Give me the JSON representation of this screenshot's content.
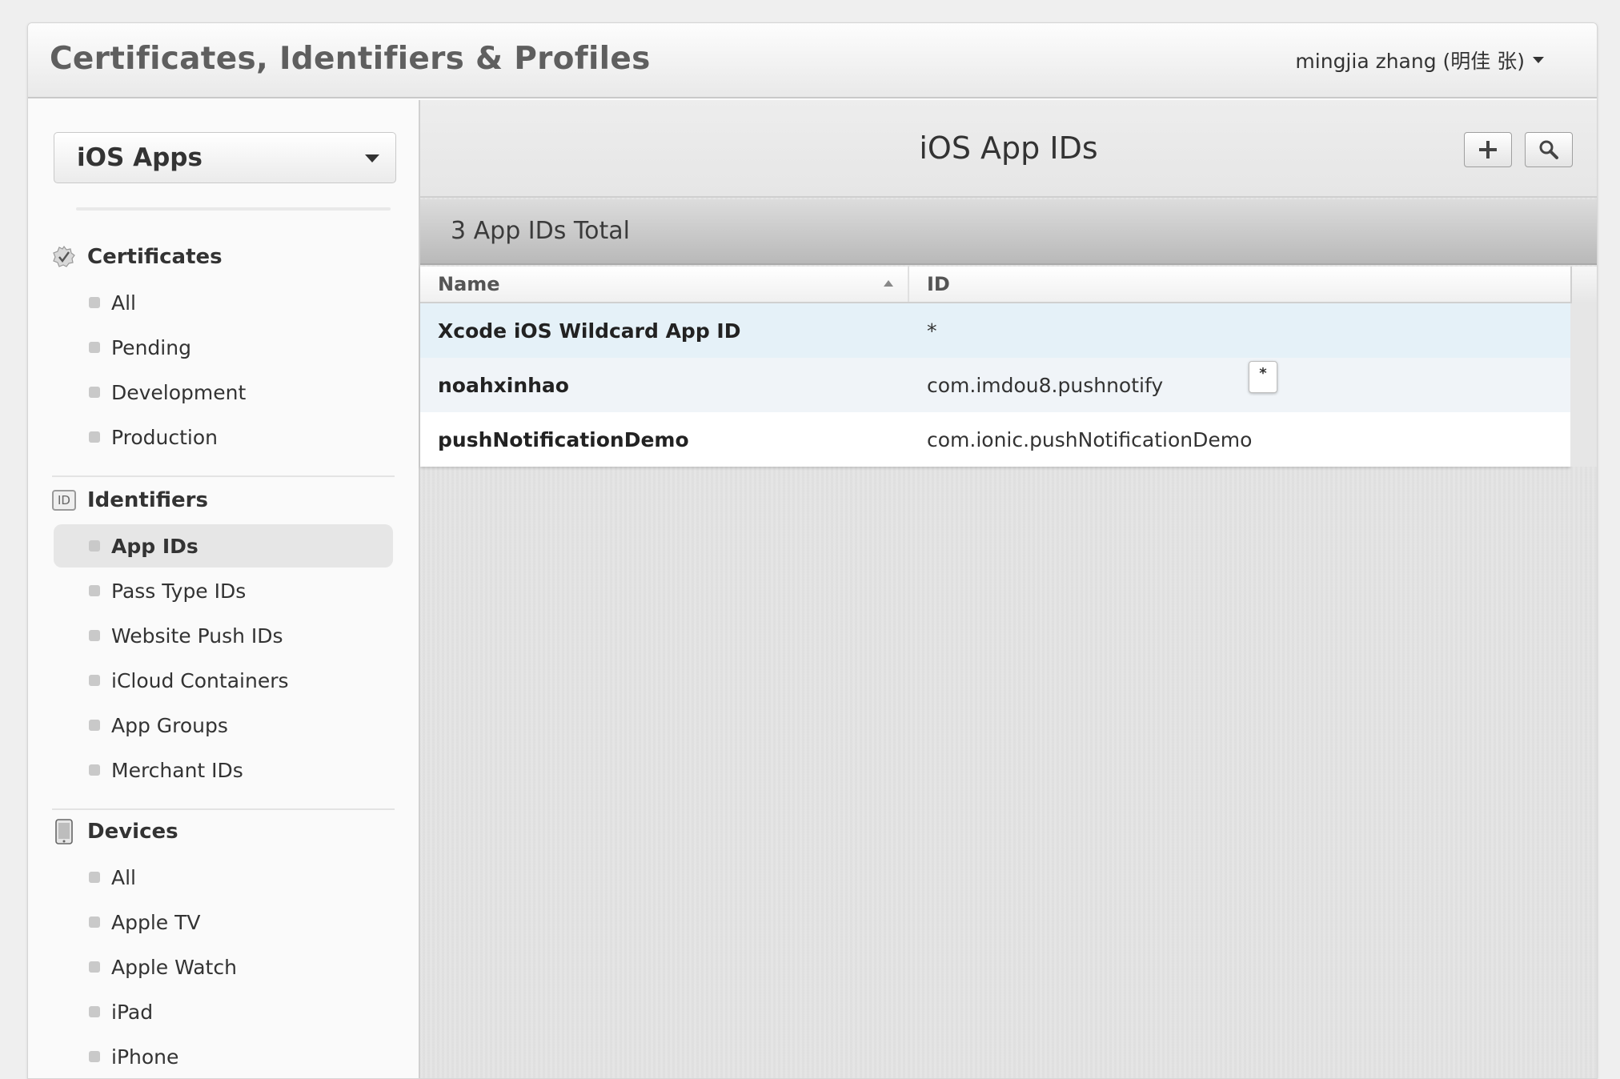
{
  "app": {
    "title": "Certificates, Identifiers & Profiles",
    "user": "mingjia zhang (明佳 张)"
  },
  "sidebar": {
    "platform": "iOS Apps",
    "sections": [
      {
        "title": "Certificates",
        "icon": "certificate-icon",
        "items": [
          "All",
          "Pending",
          "Development",
          "Production"
        ]
      },
      {
        "title": "Identifiers",
        "icon": "id-badge-icon",
        "icon_text": "ID",
        "items": [
          "App IDs",
          "Pass Type IDs",
          "Website Push IDs",
          "iCloud Containers",
          "App Groups",
          "Merchant IDs"
        ],
        "active_item": "App IDs"
      },
      {
        "title": "Devices",
        "icon": "device-icon",
        "items": [
          "All",
          "Apple TV",
          "Apple Watch",
          "iPad",
          "iPhone"
        ]
      }
    ]
  },
  "main": {
    "title": "iOS App IDs",
    "add_icon": "plus-icon",
    "search_icon": "search-icon",
    "total_text": "3 App IDs Total",
    "table": {
      "columns": [
        "Name",
        "ID"
      ],
      "rows": [
        {
          "name": "Xcode iOS Wildcard App ID",
          "id": "*"
        },
        {
          "name": "noahxinhao",
          "id": "com.imdou8.pushnotify"
        },
        {
          "name": "pushNotificationDemo",
          "id": "com.ionic.pushNotificationDemo"
        }
      ]
    },
    "tooltip_text": "*"
  },
  "colors": {
    "selected_row": "#e5f1f8",
    "hover_row": "#f0f4f8",
    "totals_bar": "#c4c4c4"
  }
}
